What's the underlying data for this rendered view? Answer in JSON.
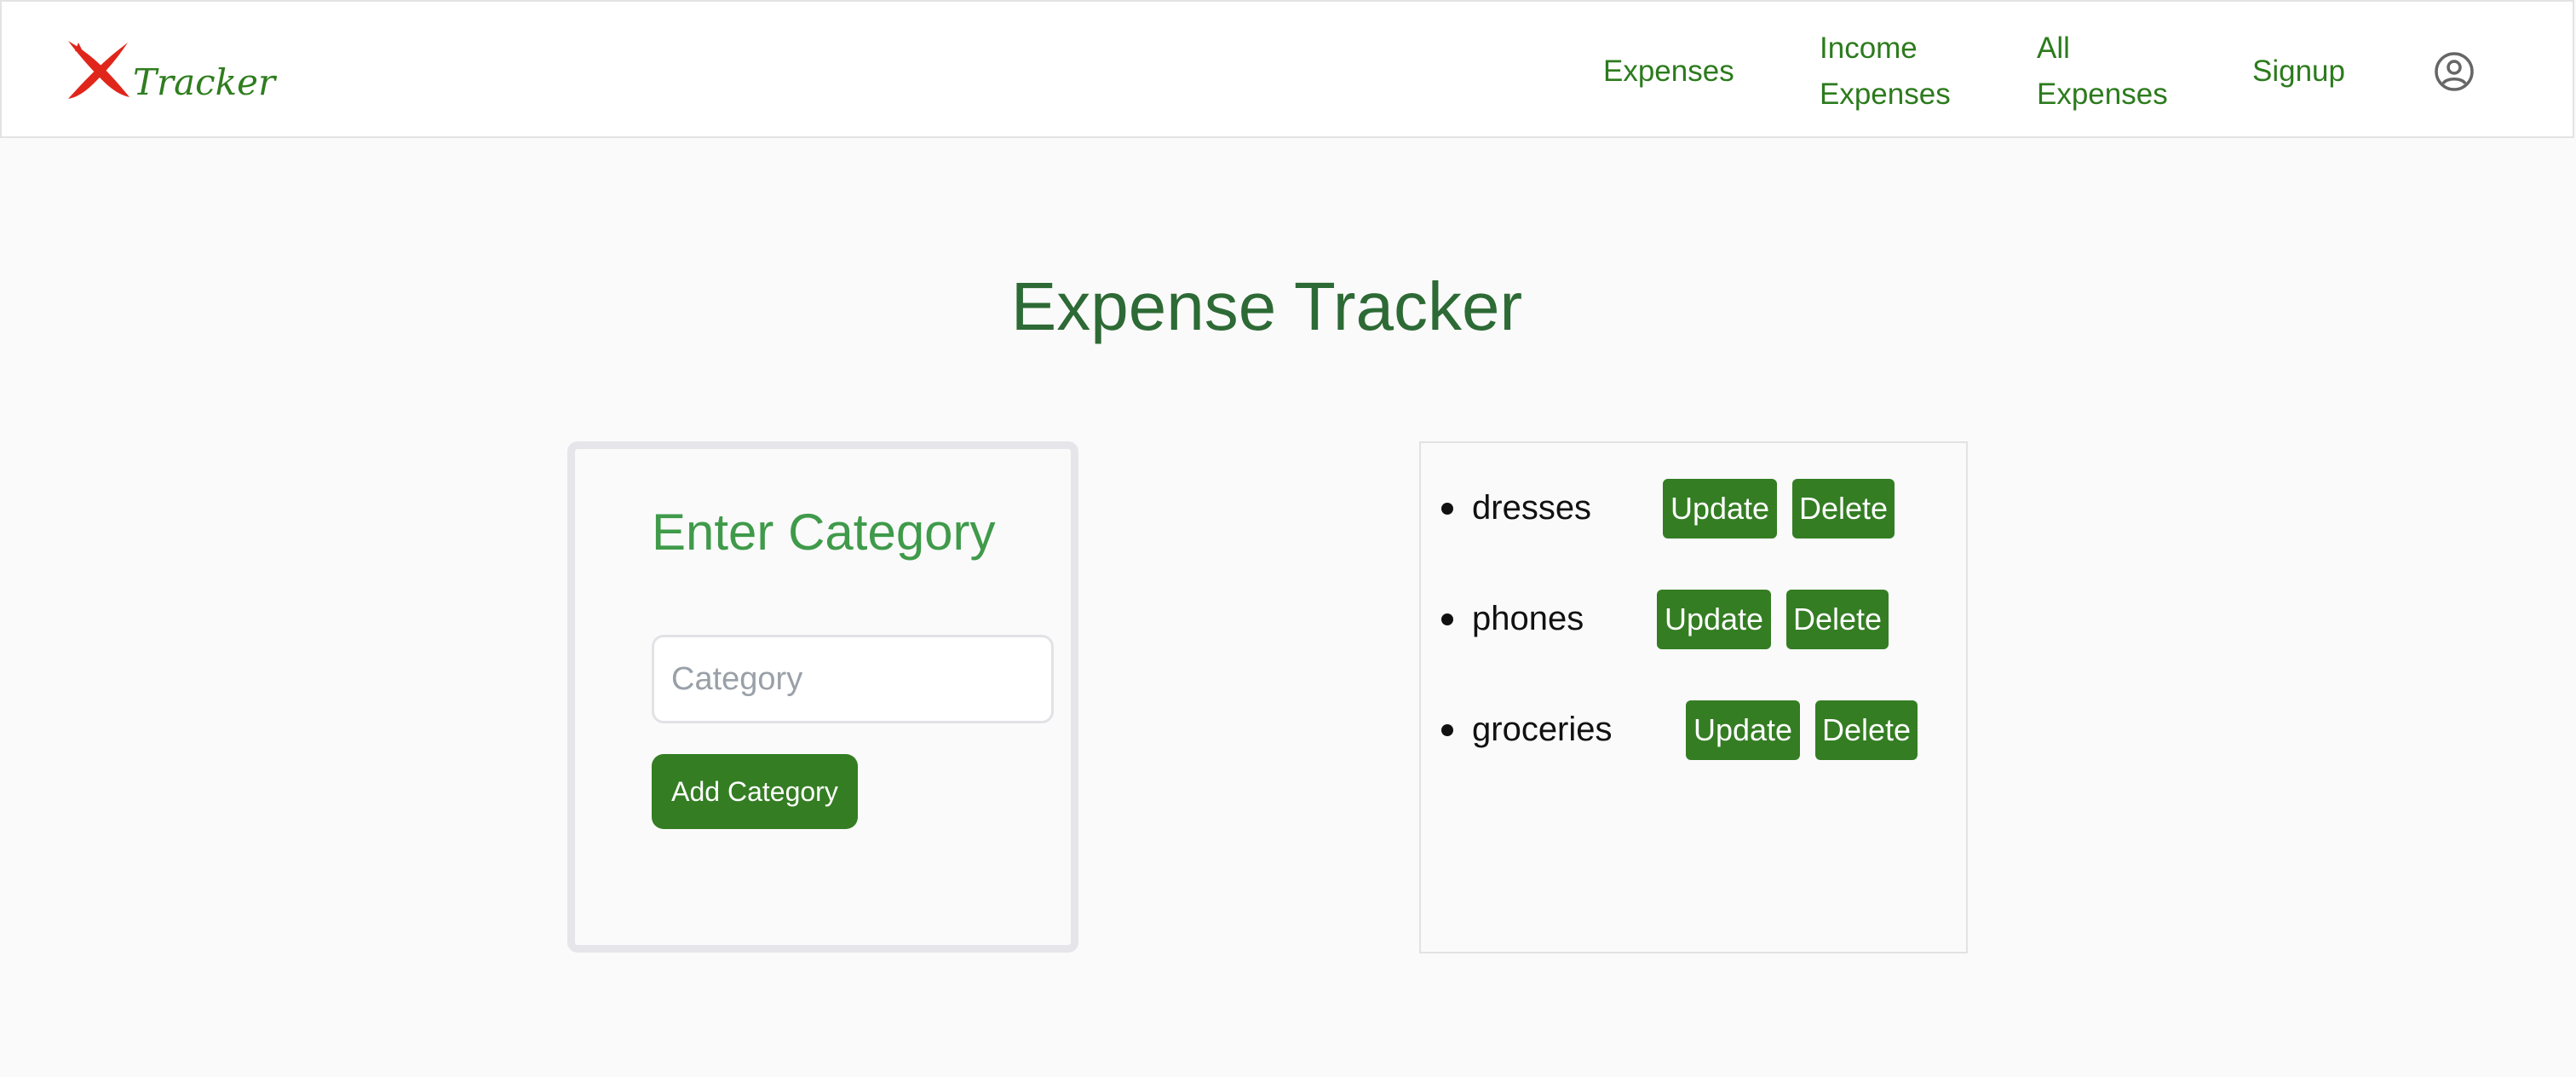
{
  "brand": {
    "logo_text": "Tracker"
  },
  "nav": {
    "expenses": "Expenses",
    "income_expenses": "Income Expenses",
    "all_expenses": "All Expenses",
    "signup": "Signup"
  },
  "main": {
    "title": "Expense Tracker"
  },
  "category_form": {
    "heading": "Enter Category",
    "input_placeholder": "Category",
    "input_value": "",
    "submit_label": "Add Category"
  },
  "categories": [
    {
      "name": "dresses",
      "update_label": "Update",
      "delete_label": "Delete"
    },
    {
      "name": "phones",
      "update_label": "Update",
      "delete_label": "Delete"
    },
    {
      "name": "groceries",
      "update_label": "Update",
      "delete_label": "Delete"
    }
  ],
  "colors": {
    "primary_green": "#347d23",
    "link_green": "#2c7b1d",
    "title_green": "#2d6a35",
    "heading_green": "#3f9a4a",
    "logo_red": "#e0261b"
  },
  "icons": {
    "logo": "x-brand-icon",
    "profile": "user-circle-icon"
  }
}
